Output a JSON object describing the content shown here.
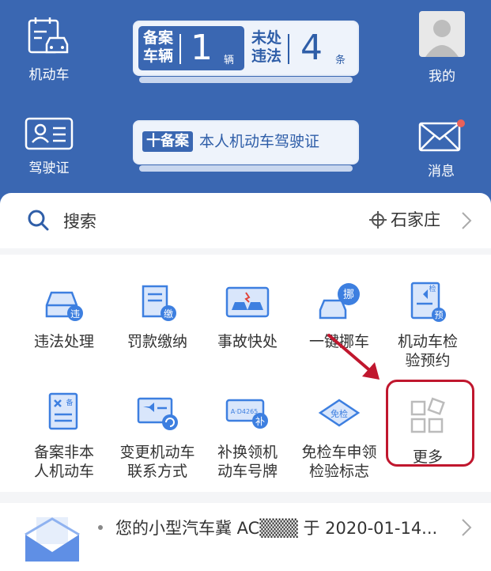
{
  "header": {
    "vehicle_label": "机动车",
    "license_label": "驾驶证",
    "mine_label": "我的",
    "messages_label": "消息",
    "filed_vehicles": {
      "label_line1": "备案",
      "label_line2": "车辆",
      "count": "1",
      "unit": "辆"
    },
    "violations": {
      "label_line1": "未处",
      "label_line2": "违法",
      "count": "4",
      "unit": "条"
    },
    "add_license": {
      "badge": "十备案",
      "text": "本人机动车驾驶证"
    }
  },
  "search": {
    "placeholder": "搜索",
    "city": "石家庄"
  },
  "services": [
    {
      "line1": "违法处理",
      "line2": ""
    },
    {
      "line1": "罚款缴纳",
      "line2": ""
    },
    {
      "line1": "事故快处",
      "line2": ""
    },
    {
      "line1": "一键挪车",
      "line2": ""
    },
    {
      "line1": "机动车检",
      "line2": "验预约"
    },
    {
      "line1": "备案非本",
      "line2": "人机动车"
    },
    {
      "line1": "变更机动车",
      "line2": "联系方式"
    },
    {
      "line1": "补换领机",
      "line2": "动车号牌"
    },
    {
      "line1": "免检车申领",
      "line2": "检验标志"
    },
    {
      "line1": "更多",
      "line2": ""
    }
  ],
  "icon_badges": {
    "violation": "违",
    "fine": "缴",
    "move": "挪",
    "inspect_top": "检",
    "inspect": "预",
    "filing": "备",
    "plate_text": "A·D4265",
    "plate_badge": "补",
    "exempt": "免检"
  },
  "notice": {
    "text": "您的小型汽车冀 AC▒▒▒ 于 2020-01-14..."
  },
  "colors": {
    "brand_blue": "#3a67b2",
    "accent_red": "#c0172e",
    "icon_blue": "#3d7fe0"
  }
}
